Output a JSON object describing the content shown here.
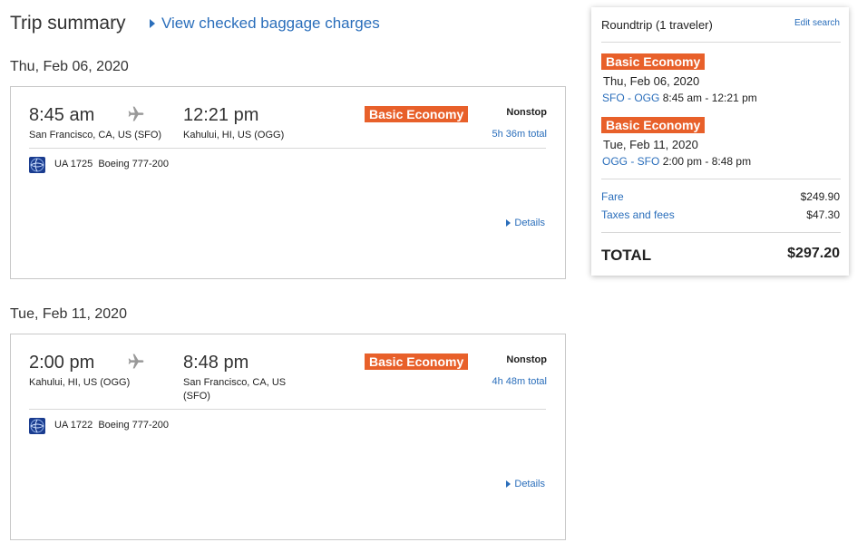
{
  "header": {
    "title": "Trip summary",
    "baggage_link": "View checked baggage charges"
  },
  "flights": [
    {
      "date": "Thu, Feb 06, 2020",
      "depart_time": "8:45 am",
      "depart_airport": "San Francisco, CA, US (SFO)",
      "arrive_time": "12:21 pm",
      "arrive_airport": "Kahului, HI, US (OGG)",
      "fare_class": "Basic Economy",
      "stops": "Nonstop",
      "duration": "5h 36m total",
      "flight_number": "UA 1725",
      "aircraft": "Boeing 777-200",
      "details_label": "Details"
    },
    {
      "date": "Tue, Feb 11, 2020",
      "depart_time": "2:00 pm",
      "depart_airport": "Kahului, HI, US (OGG)",
      "arrive_time": "8:48 pm",
      "arrive_airport": "San Francisco, CA, US (SFO)",
      "fare_class": "Basic Economy",
      "stops": "Nonstop",
      "duration": "4h 48m total",
      "flight_number": "UA 1722",
      "aircraft": "Boeing 777-200",
      "details_label": "Details"
    }
  ],
  "summary": {
    "trip_type": "Roundtrip (1 traveler)",
    "edit_label": "Edit search",
    "segments": [
      {
        "fare_class": "Basic Economy",
        "date": "Thu, Feb 06, 2020",
        "route": "SFO - OGG",
        "times": "8:45 am - 12:21 pm"
      },
      {
        "fare_class": "Basic Economy",
        "date": "Tue, Feb 11, 2020",
        "route": "OGG - SFO",
        "times": "2:00 pm - 8:48 pm"
      }
    ],
    "fare_label": "Fare",
    "fare_value": "$249.90",
    "taxes_label": "Taxes and fees",
    "taxes_value": "$47.30",
    "total_label": "TOTAL",
    "total_value": "$297.20"
  },
  "colors": {
    "accent_link": "#2a6ebb",
    "badge": "#e8602a",
    "logo": "#1a3c8f"
  },
  "icons": {
    "plane": "plane-icon",
    "airline_logo": "united-globe-logo-icon",
    "caret": "caret-right-icon"
  }
}
